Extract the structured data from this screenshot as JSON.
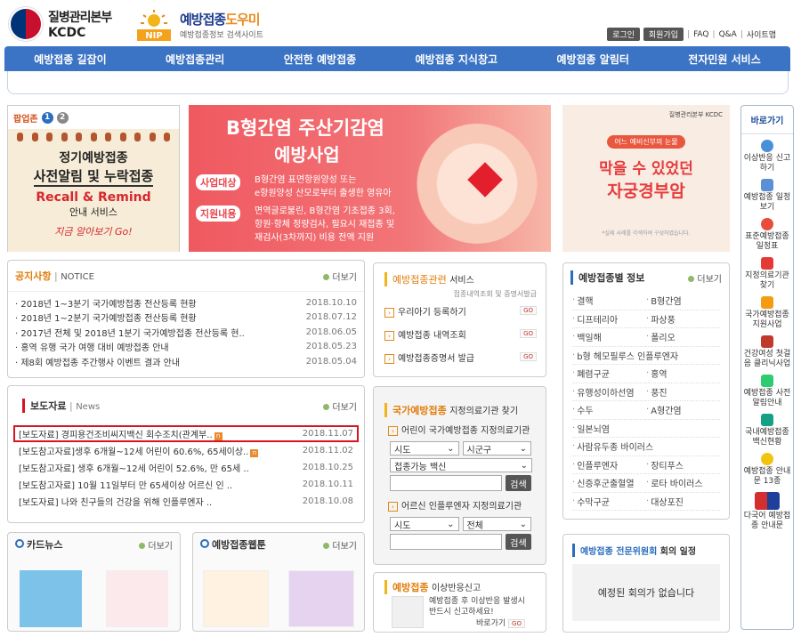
{
  "header": {
    "kdca_name": "질병관리본부",
    "kdca_abbr": "KCDC",
    "nip_title_a": "예방접종",
    "nip_title_b": "도우미",
    "nip_badge": "NIP",
    "nip_sub": "예방접종정보 검색사이트",
    "util": {
      "login": "로그인",
      "join": "회원가입",
      "faq": "FAQ",
      "qa": "Q&A",
      "sitemap": "사이트맵"
    }
  },
  "nav": [
    "예방접종 길잡이",
    "예방접종관리",
    "안전한 예방접종",
    "예방접종 지식창고",
    "예방접종 알림터",
    "전자민원 서비스"
  ],
  "popup": {
    "title": "팝업존",
    "pages": [
      "1",
      "2"
    ],
    "line1": "정기예방접종",
    "line2": "사전알림 및 누락접종",
    "line3": "Recall & Remind",
    "line4": "안내 서비스",
    "line5": "지금 알아보기 Go!"
  },
  "banner_hepb": {
    "title1": "B형간염 주산기감염",
    "title2": "예방사업",
    "tag1": "사업대상",
    "text1a": "B형간염 표면항원양성 또는",
    "text1b": "e항원양성 산모로부터 출생한 영유아",
    "tag2": "지원내용",
    "text2a": "면역글로불린, B형간염 기초접종 3회,",
    "text2b": "항원·항체 정량검사, 필요시 재접종 및",
    "text2c": "재검사(3차까지) 비용 전액 지원"
  },
  "banner_hpv": {
    "logo": "질병관리본부 KCDC",
    "bubble": "어느 예비신부의 눈물",
    "line1": "막을 수 있었던",
    "line2": "자궁경부암",
    "foot": "*실제 사례를 각색하여 구성하였습니다."
  },
  "quick": {
    "title": "바로가기",
    "items": [
      "이상반응 신고하기",
      "예방접종 일정보기",
      "표준예방접종 일정표",
      "지정의료기관 찾기",
      "국가예방접종 지원사업",
      "건강여성 첫걸음 클리닉사업",
      "예방접종 사전알림안내",
      "국내예방접종 백신현황",
      "예방접종 안내문 13종",
      "다국어 예방접종 안내문"
    ]
  },
  "notice": {
    "title": "공지사항",
    "title_en": "NOTICE",
    "more": "더보기",
    "rows": [
      {
        "t": "2018년 1~3분기 국가예방접종 전산등록 현황",
        "d": "2018.10.10"
      },
      {
        "t": "2018년 1~2분기 국가예방접종 전산등록 현황",
        "d": "2018.07.12"
      },
      {
        "t": "2017년 전체 및 2018년 1분기 국가예방접종 전산등록 현..",
        "d": "2018.06.05"
      },
      {
        "t": "홍역 유행 국가 여행 대비 예방접종 안내",
        "d": "2018.05.23"
      },
      {
        "t": "제8회 예방접종 주간행사 이벤트 결과 안내",
        "d": "2018.05.04"
      }
    ]
  },
  "news": {
    "title": "보도자료",
    "title_en": "News",
    "more": "더보기",
    "new_badge": "n",
    "rows": [
      {
        "t": "[보도자료] 경피용건조비씨지백신 회수조치(관계부..",
        "d": "2018.11.07",
        "new": true
      },
      {
        "t": "[보도참고자료]생후 6개월~12세 어린이 60.6%, 65세이상..",
        "d": "2018.11.02",
        "new": true
      },
      {
        "t": "[보도참고자료] 생후 6개월~12세 어린이 52.6%, 만 65세 ..",
        "d": "2018.10.25",
        "new": false
      },
      {
        "t": "[보도참고자료] 10월 11일부터 만 65세이상 어르신 인 ..",
        "d": "2018.10.11",
        "new": false
      },
      {
        "t": "[보도자료] 나와 친구들의 건강을 위해 인플루엔자 ..",
        "d": "2018.10.08",
        "new": false
      }
    ]
  },
  "cardnews": {
    "title": "카드뉴스",
    "more": "더보기"
  },
  "webtoon": {
    "title": "예방접종웹툰",
    "more": "더보기"
  },
  "service": {
    "title_a": "예방접종관련",
    "title_b": "서비스",
    "sub": "접종내역조회 및 증명서발급",
    "go": "GO",
    "items": [
      "우리아기 등록하기",
      "예방접종 내역조회",
      "예방접종증명서 발급"
    ]
  },
  "clinic": {
    "title_a": "국가예방접종",
    "title_b": "지정의료기관 찾기",
    "child": "어린이 국가예방접종 지정의료기관",
    "sel_sido": "시도",
    "sel_sigungu": "시군구",
    "sel_vaccine": "접종가능 백신",
    "search": "검색",
    "adult": "어르신 인플루엔자 지정의료기관",
    "sel_sido2": "시도",
    "sel_all": "전체",
    "search2": "검색"
  },
  "adverse": {
    "title_a": "예방접종",
    "title_b": "이상반응신고",
    "text1": "예방접종 후 이상반응 발생시",
    "text2": "반드시 신고하세요!",
    "link": "바로가기",
    "go": "GO"
  },
  "disease": {
    "title_a": "예방접종별",
    "title_b": "정보",
    "more": "더보기",
    "items": [
      "결핵",
      "B형간염",
      "디프테리아",
      "파상풍",
      "백일해",
      "폴리오",
      "b형 헤모필루스 인플루엔자",
      "",
      "폐렴구균",
      "홍역",
      "유행성이하선염",
      "풍진",
      "수두",
      "A형간염",
      "일본뇌염",
      "",
      "사람유두종 바이러스",
      "",
      "인플루엔자",
      "장티푸스",
      "신증후군출혈열",
      "로타 바이러스",
      "수막구균",
      "대상포진"
    ]
  },
  "committee": {
    "title_a": "예방접종 전문위원회",
    "title_b": "회의 일정",
    "empty": "예정된 회의가 없습니다"
  },
  "colors": {
    "nav": "#3b73c5",
    "accent": "#e8454e",
    "highlight_border": "#d7141f"
  }
}
